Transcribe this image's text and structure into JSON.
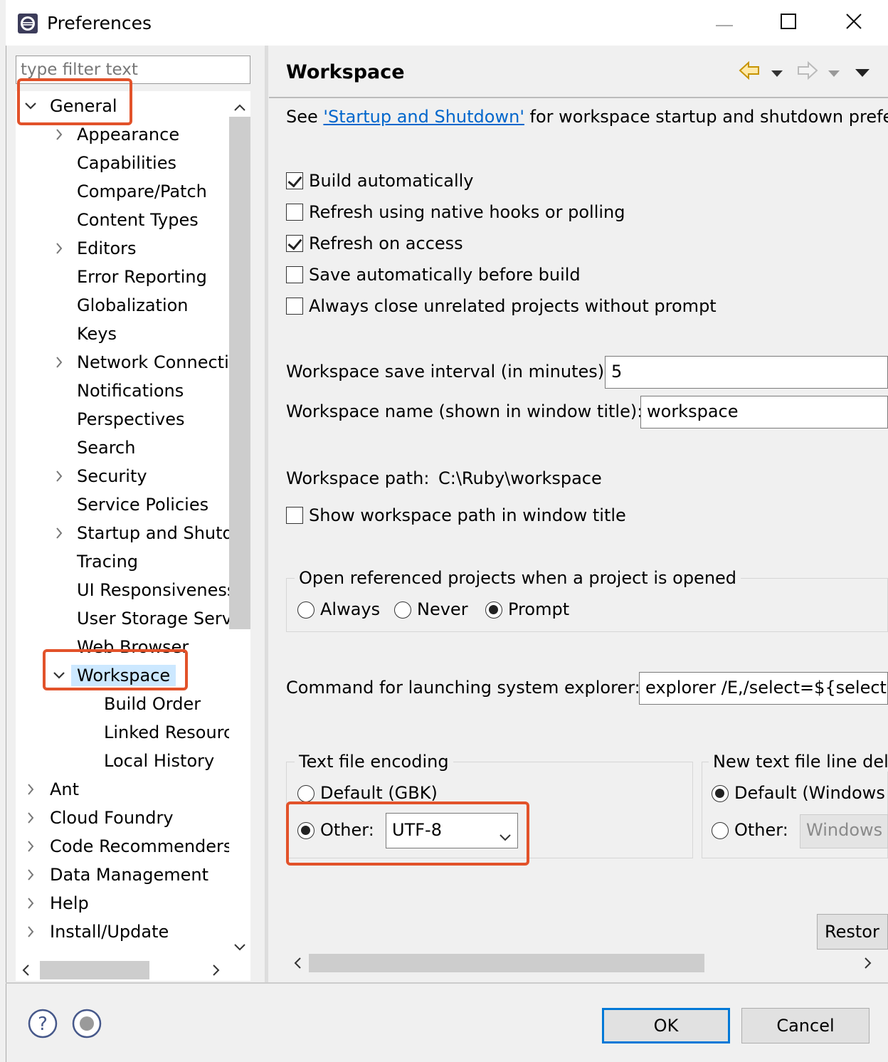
{
  "window": {
    "title": "Preferences"
  },
  "left": {
    "filter_placeholder": "type filter text",
    "tree": [
      {
        "label": "General",
        "level": 0,
        "expanded": true
      },
      {
        "label": "Appearance",
        "level": 1,
        "collapsed": true
      },
      {
        "label": "Capabilities",
        "level": 1
      },
      {
        "label": "Compare/Patch",
        "level": 1
      },
      {
        "label": "Content Types",
        "level": 1
      },
      {
        "label": "Editors",
        "level": 1,
        "collapsed": true
      },
      {
        "label": "Error Reporting",
        "level": 1
      },
      {
        "label": "Globalization",
        "level": 1
      },
      {
        "label": "Keys",
        "level": 1
      },
      {
        "label": "Network Connecti",
        "level": 1,
        "collapsed": true
      },
      {
        "label": "Notifications",
        "level": 1
      },
      {
        "label": "Perspectives",
        "level": 1
      },
      {
        "label": "Search",
        "level": 1
      },
      {
        "label": "Security",
        "level": 1,
        "collapsed": true
      },
      {
        "label": "Service Policies",
        "level": 1
      },
      {
        "label": "Startup and Shutd",
        "level": 1,
        "collapsed": true
      },
      {
        "label": "Tracing",
        "level": 1
      },
      {
        "label": "UI Responsiveness",
        "level": 1
      },
      {
        "label": "User Storage Serv",
        "level": 1
      },
      {
        "label": "Web Browser",
        "level": 1
      },
      {
        "label": "Workspace",
        "level": 1,
        "expanded": true,
        "selected": true
      },
      {
        "label": "Build Order",
        "level": 2
      },
      {
        "label": "Linked Resourc",
        "level": 2
      },
      {
        "label": "Local History",
        "level": 2
      },
      {
        "label": "Ant",
        "level": 0,
        "collapsed": true
      },
      {
        "label": "Cloud Foundry",
        "level": 0,
        "collapsed": true
      },
      {
        "label": "Code Recommenders",
        "level": 0,
        "collapsed": true
      },
      {
        "label": "Data Management",
        "level": 0,
        "collapsed": true
      },
      {
        "label": "Help",
        "level": 0,
        "collapsed": true
      },
      {
        "label": "Install/Update",
        "level": 0,
        "collapsed": true
      }
    ]
  },
  "page": {
    "title": "Workspace",
    "intro_prefix": "See ",
    "intro_link": "'Startup and Shutdown'",
    "intro_suffix": " for workspace startup and shutdown prefer",
    "checkboxes": [
      {
        "label": "Build automatically",
        "checked": true
      },
      {
        "label": "Refresh using native hooks or polling",
        "checked": false
      },
      {
        "label": "Refresh on access",
        "checked": true
      },
      {
        "label": "Save automatically before build",
        "checked": false
      },
      {
        "label": "Always close unrelated projects without prompt",
        "checked": false
      }
    ],
    "save_interval_label": "Workspace save interval (in minutes):",
    "save_interval_value": "5",
    "name_label": "Workspace name (shown in window title):",
    "name_value": "workspace",
    "path_label": "Workspace path:",
    "path_value": "C:\\Ruby\\workspace",
    "show_path_label": "Show workspace path in window title",
    "open_group_label": "Open referenced projects when a project is opened",
    "open_options": [
      {
        "label": "Always",
        "selected": false
      },
      {
        "label": "Never",
        "selected": false
      },
      {
        "label": "Prompt",
        "selected": true
      }
    ],
    "explorer_label": "Command for launching system explorer:",
    "explorer_value": "explorer /E,/select=${selecte",
    "encoding": {
      "group_label": "Text file encoding",
      "default_label": "Default (GBK)",
      "other_label": "Other:",
      "other_value": "UTF-8",
      "selected": "other"
    },
    "line_delim": {
      "group_label": "New text file line del",
      "default_label": "Default (Windows",
      "other_label": "Other:",
      "other_value": "Windows",
      "selected": "default"
    },
    "restore_label": "Restor"
  },
  "footer": {
    "ok_label": "OK",
    "cancel_label": "Cancel"
  }
}
